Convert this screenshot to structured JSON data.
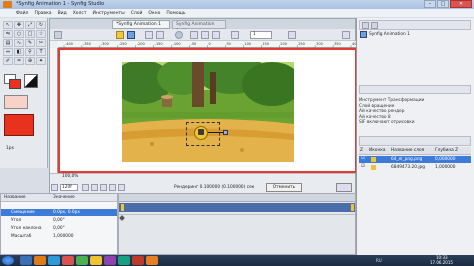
{
  "window": {
    "title": "*Synfig Animation 1 - Synfig Studio",
    "minimize": "–",
    "maximize": "□",
    "close": "✕"
  },
  "menu": [
    "Файл",
    "Правка",
    "Вид",
    "Холст",
    "Инструменты",
    "Слой",
    "Окно",
    "Помощь"
  ],
  "colors": {
    "accent_red": "#e53935",
    "timeline_blue": "#4a6ea9",
    "selected_row": "#3d7bd9",
    "fill_red": "#e8321e",
    "outline_red": "#d4361c"
  },
  "document": {
    "active_tab": "*Synfig Animation 1",
    "inactive_tab": "Synfig Animation 1.sifz",
    "zoom": "100,0%",
    "frame_field": "120f",
    "render_status": "Рендеринг 0.100000 (0.100000) сек",
    "cancel_button": "Отменить",
    "ruler_marks": [
      "-400",
      "-350",
      "-300",
      "-250",
      "-200",
      "-150",
      "-100",
      "-50",
      "0",
      "50",
      "100",
      "150",
      "200",
      "250",
      "300",
      "350",
      "400"
    ],
    "onion_value": "1"
  },
  "toolbox": {
    "size_label": "1px",
    "icons": [
      "transform-icon",
      "smooth-move-icon",
      "scale-icon",
      "rotate-icon",
      "mirror-icon",
      "circle-icon",
      "rectangle-icon",
      "star-icon",
      "gradient-icon",
      "spline-icon",
      "draw-icon",
      "cutout-icon",
      "width-icon",
      "fill-icon",
      "eyedrop-icon",
      "text-icon",
      "sketch-icon",
      "brush-icon",
      "zoom-icon",
      "bone-icon"
    ]
  },
  "params": {
    "col_name": "Название",
    "col_value": "Значение",
    "rows": [
      {
        "name": "Смещение",
        "value": "0.0px, 0.0px",
        "selected": true
      },
      {
        "name": "Угол",
        "value": "0,00°",
        "selected": false
      },
      {
        "name": "Угол наклона",
        "value": "0,00°",
        "selected": false
      },
      {
        "name": "Масштаб",
        "value": "1,000000",
        "selected": false
      }
    ]
  },
  "right_panel": {
    "canvas_browser_item": "Synfig Animation 1",
    "log_lines": [
      "Инструмент Трансформации",
      "Слой вращение",
      "Ай качество рендер",
      "Ай качество 8",
      "SIF включают отрисовки"
    ],
    "layers_headers": [
      "Z",
      "Иконка",
      "Название слоя",
      "Глубина Z"
    ],
    "layers": [
      {
        "name": "64_el_png.png",
        "z": "0,000000",
        "selected": true
      },
      {
        "name": "6849473.20.jpg",
        "z": "1,000000",
        "selected": false
      }
    ]
  },
  "taskbar": {
    "clock": "10:33",
    "date": "17.06.2015",
    "lang": "RU"
  }
}
